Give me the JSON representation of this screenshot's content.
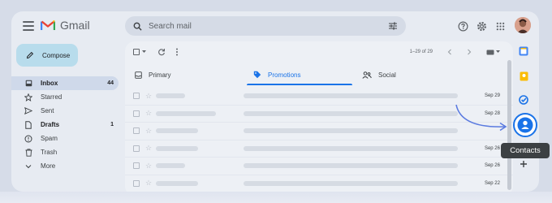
{
  "app": {
    "name": "Gmail"
  },
  "search": {
    "placeholder": "Search mail"
  },
  "compose": {
    "label": "Compose"
  },
  "sidebar": {
    "items": [
      {
        "label": "Inbox",
        "count": "44",
        "icon": "inbox-icon"
      },
      {
        "label": "Starred",
        "count": "",
        "icon": "star-icon"
      },
      {
        "label": "Sent",
        "count": "",
        "icon": "send-icon"
      },
      {
        "label": "Drafts",
        "count": "1",
        "icon": "draft-icon"
      },
      {
        "label": "Spam",
        "count": "",
        "icon": "spam-icon"
      },
      {
        "label": "Trash",
        "count": "",
        "icon": "trash-icon"
      },
      {
        "label": "More",
        "count": "",
        "icon": "chevron-down-icon"
      }
    ]
  },
  "toolbar": {
    "pagination": "1–29 of 29"
  },
  "tabs": [
    {
      "label": "Primary",
      "icon": "inbox-icon"
    },
    {
      "label": "Promotions",
      "icon": "tag-icon"
    },
    {
      "label": "Social",
      "icon": "people-icon"
    }
  ],
  "emails": [
    {
      "date": "Sep 29"
    },
    {
      "date": "Sep 28"
    },
    {
      "date": ""
    },
    {
      "date": "Sep 26"
    },
    {
      "date": "Sep 26"
    },
    {
      "date": "Sep 22"
    }
  ],
  "tooltip": {
    "label": "Contacts"
  },
  "colors": {
    "accent": "#1a73e8",
    "compose_bg": "#b8dcec",
    "tooltip_bg": "#3c4043"
  }
}
